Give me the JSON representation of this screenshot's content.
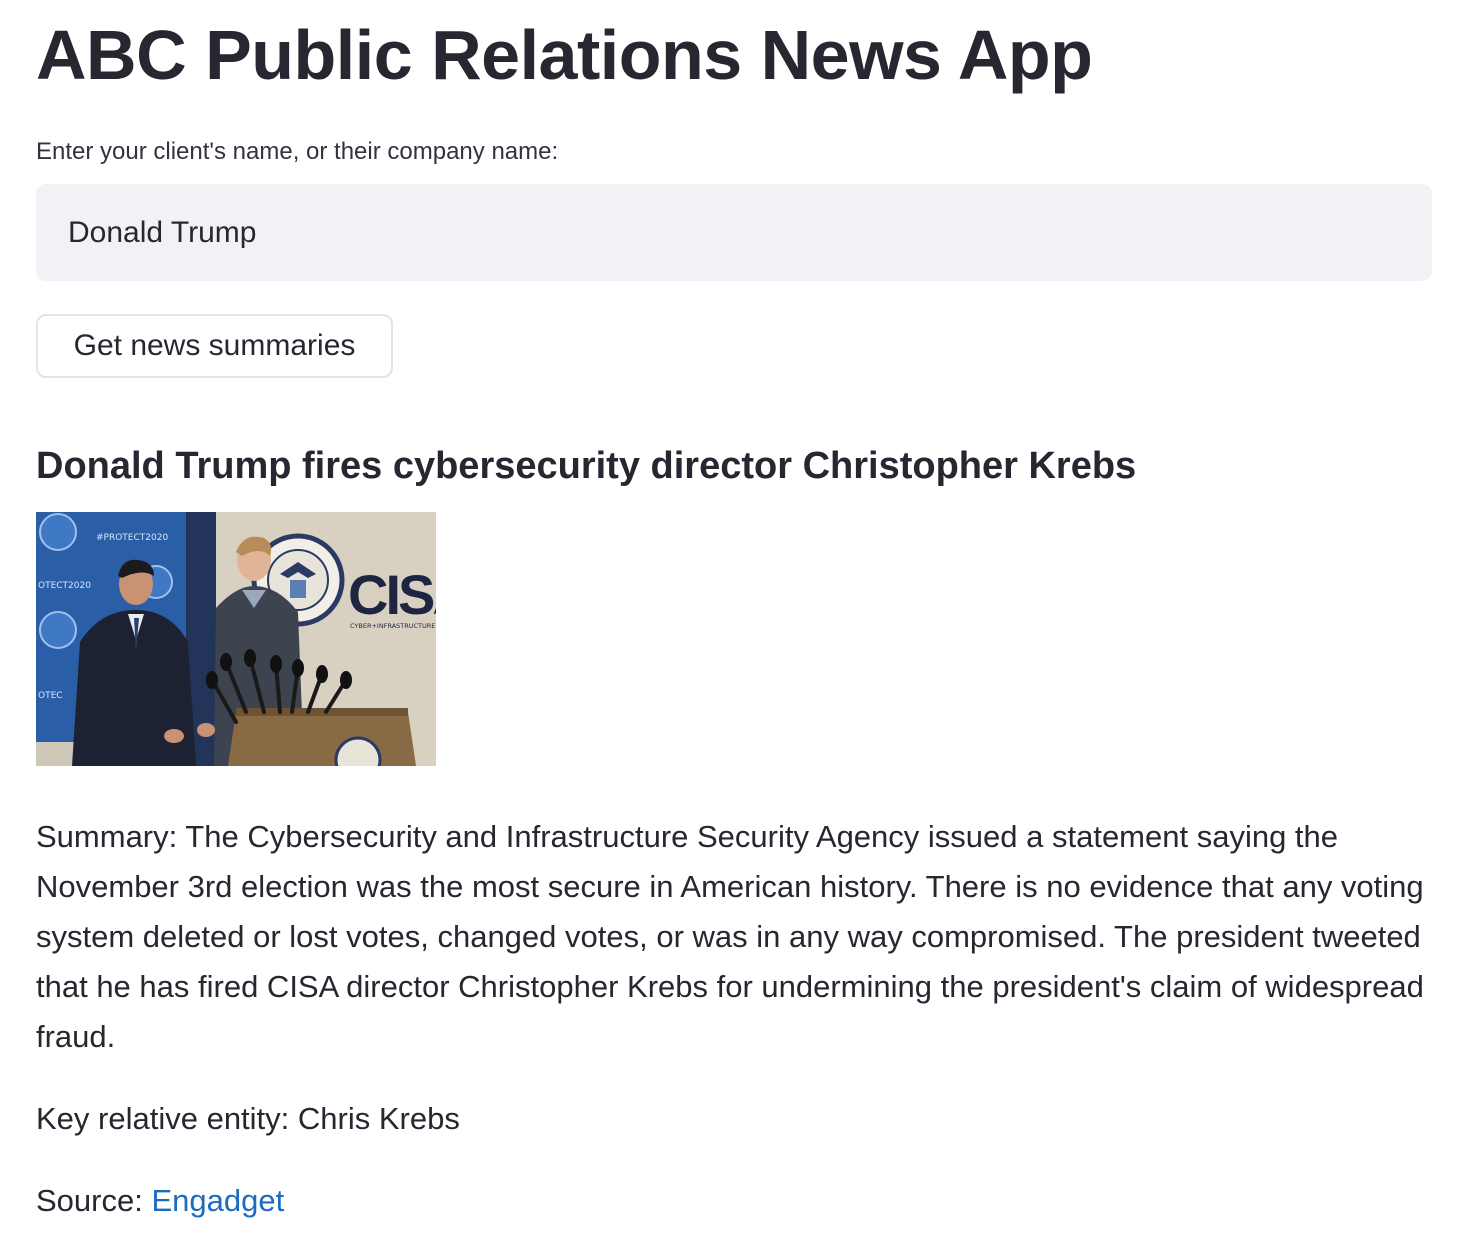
{
  "app": {
    "title": "ABC Public Relations News App"
  },
  "search": {
    "label": "Enter your client's name, or their company name:",
    "value": "Donald Trump"
  },
  "actions": {
    "get_summaries_label": "Get news summaries"
  },
  "article": {
    "title": "Donald Trump fires cybersecurity director Christopher Krebs",
    "image": {
      "icon": "news-photo",
      "sign_text": "CISA",
      "sign_subtext": "CYBER+INFRASTRUCTURE",
      "banner_text": "#PROTECT2020"
    },
    "summary": "Summary: The Cybersecurity and Infrastructure Security Agency issued a statement saying the November 3rd election was the most secure in American history. There is no evidence that any voting system deleted or lost votes, changed votes, or was in any way compromised. The president tweeted that he has fired CISA director Christopher Krebs for undermining the president's claim of widespread fraud.",
    "key_entity_label": "Key relative entity: Chris Krebs",
    "source_prefix": "Source: ",
    "source_link_text": "Engadget"
  },
  "colors": {
    "text": "#262730",
    "input_bg": "#f0f2f6",
    "link": "#1c6bc0"
  }
}
